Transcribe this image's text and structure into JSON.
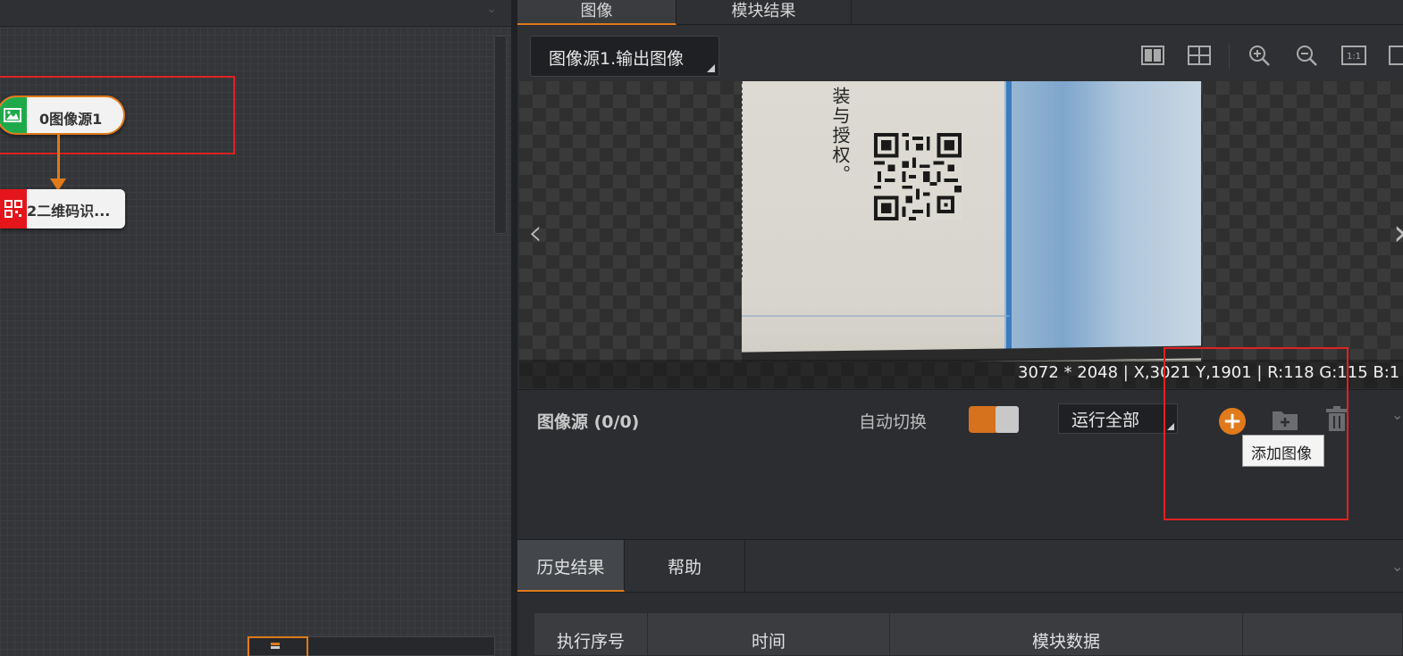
{
  "flow": {
    "nodes": [
      {
        "label": "0图像源1",
        "icon": "image-icon"
      },
      {
        "label": "2二维码识...",
        "icon": "qrcode-icon"
      }
    ]
  },
  "top_tabs": [
    {
      "label": "图像",
      "active": true
    },
    {
      "label": "模块结果",
      "active": false
    }
  ],
  "viewer": {
    "image_selector": "图像源1.输出图像",
    "photo_text": "装与授权。",
    "status": "3072 * 2048  |  X,3021  Y,1901  |  R:118  G:115  B:1",
    "nav_prev": "‹",
    "nav_next": "›"
  },
  "toolbar_icons": [
    "layout-single-icon",
    "layout-grid-icon",
    "zoom-in-icon",
    "zoom-out-icon",
    "actual-size-icon",
    "fit-icon"
  ],
  "image_source": {
    "title": "图像源 (0/0)",
    "auto_switch_label": "自动切换",
    "auto_switch_on": true,
    "run_mode": "运行全部",
    "add_image_tooltip": "添加图像"
  },
  "history_tabs": [
    {
      "label": "历史结果",
      "active": true
    },
    {
      "label": "帮助",
      "active": false
    }
  ],
  "history_table": {
    "columns": [
      "执行序号",
      "时间",
      "模块数据",
      ""
    ]
  },
  "colors": {
    "accent": "#e07a1a",
    "highlight": "#e02222",
    "node_green": "#1faa4a",
    "node_red": "#e4161b"
  }
}
